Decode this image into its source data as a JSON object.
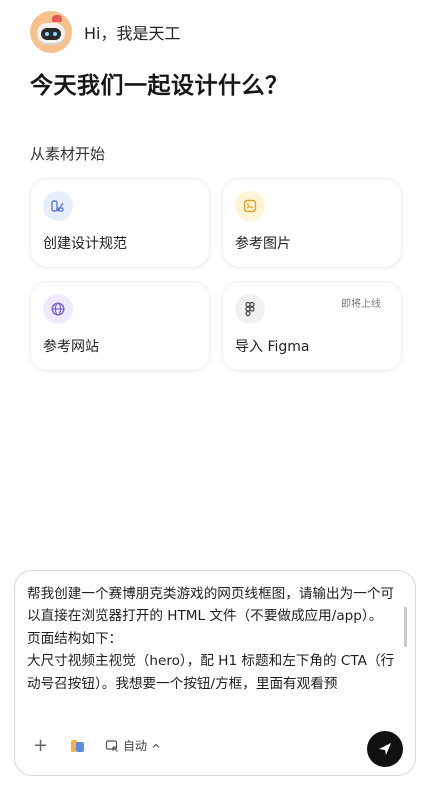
{
  "header": {
    "greeting": "Hi，我是天工"
  },
  "title": "今天我们一起设计什么？",
  "section_label": "从素材开始",
  "cards": [
    {
      "label": "创建设计规范",
      "icon": "design-spec-icon"
    },
    {
      "label": "参考图片",
      "icon": "image-icon"
    },
    {
      "label": "参考网站",
      "icon": "globe-icon"
    },
    {
      "label": "导入 Figma",
      "icon": "figma-icon",
      "tag": "即将上线"
    }
  ],
  "composer": {
    "text": "帮我创建一个赛博朋克类游戏的网页线框图，请输出为一个可以直接在浏览器打开的 HTML 文件（不要做成应用/app）。\n页面结构如下：\n大尺寸视频主视觉（hero），配 H1 标题和左下角的 CTA（行动号召按钮）。我想要一个按钮/方框，里面有观看预",
    "mode_label": "自动"
  }
}
